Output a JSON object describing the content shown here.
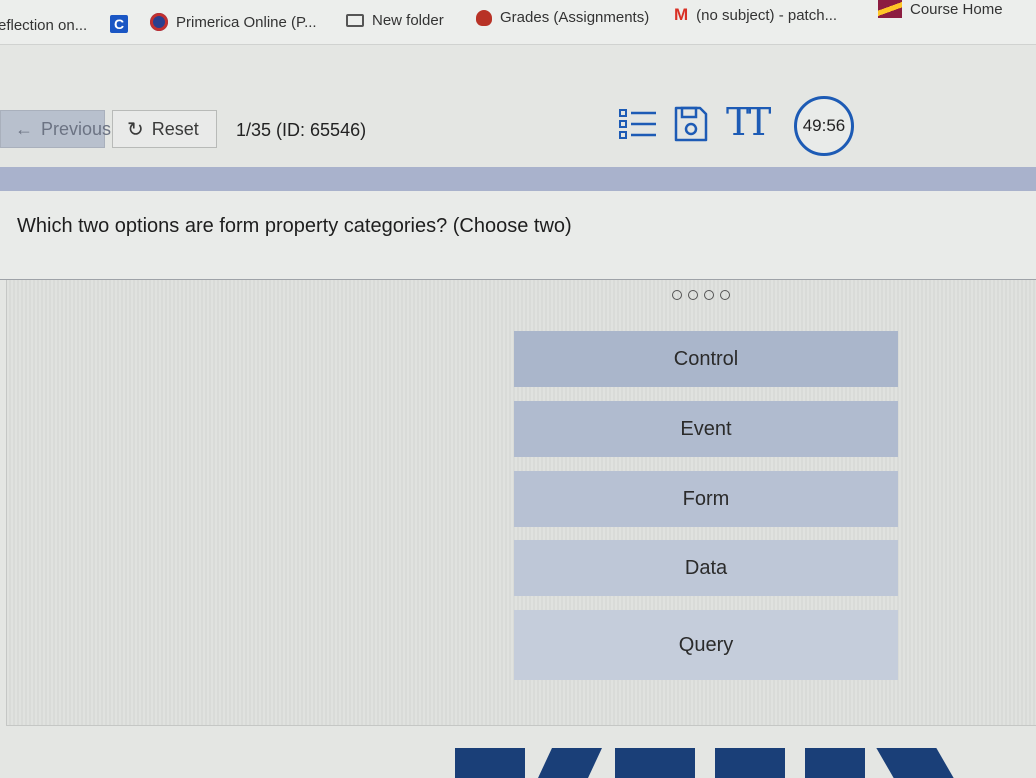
{
  "bookmarks": [
    {
      "label": "eflection on...",
      "icon": "none"
    },
    {
      "label": "",
      "icon": "c-square-icon"
    },
    {
      "label": "Primerica Online (P...",
      "icon": "primerica-icon"
    },
    {
      "label": "New folder",
      "icon": "folder-icon"
    },
    {
      "label": "Grades (Assignments)",
      "icon": "grades-icon"
    },
    {
      "label": "(no subject) - patch...",
      "icon": "gmail-icon"
    },
    {
      "label": "Course Home",
      "icon": "course-home-icon"
    }
  ],
  "toolbar": {
    "previous_label": "Previous",
    "previous_arrow": "←",
    "reset_label": "Reset",
    "reset_icon_glyph": "↻",
    "counter": "1/35 (ID: 65546)",
    "font_icon_text": "TT",
    "timer": "49:56"
  },
  "question": {
    "text": "Which two options are form property categories? (Choose two)"
  },
  "options": [
    {
      "label": "Control"
    },
    {
      "label": "Event"
    },
    {
      "label": "Form"
    },
    {
      "label": "Data"
    },
    {
      "label": "Query"
    }
  ],
  "colors": {
    "accent": "#1d5bb5",
    "band": "#a9b2cc",
    "option_bg": "#b5c0d3"
  }
}
